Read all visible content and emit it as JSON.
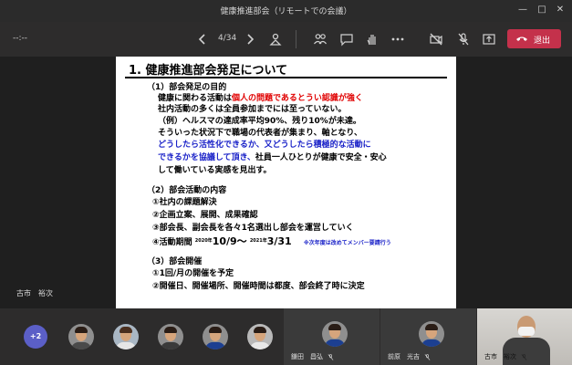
{
  "window": {
    "title": "健康推進部会（リモートでの会議）",
    "minimize": "—",
    "maximize": "□",
    "close": "✕"
  },
  "toolbar": {
    "timer": "--:--",
    "page_counter": "4/34",
    "leave_label": "退出",
    "accent": "#c4314b"
  },
  "slide": {
    "title": "1. 健康推進部会発足について",
    "section1": {
      "heading": "（1）部会発足の目的",
      "l1a": "健康に関わる活動は",
      "l1b": "個人の問題であるとうい認識が強く",
      "l2": "社内活動の多くは全員参加までには至っていない。",
      "l3": "（例）ヘルスマの達成率平均90%、残り10%が未達。",
      "l4": "そういった状況下で職場の代表者が集まり、軸となり、",
      "l5": "どうしたら活性化できるか、又どうしたら積極的な活動に",
      "l6a": "できるかを協議して頂き、",
      "l6b": "社員一人ひとりが健康で安全・安心",
      "l7": "して働いている実感を見出す。"
    },
    "section2": {
      "heading": "（2）部会活動の内容",
      "i1": "①社内の課題解決",
      "i2": "②企画立案、展開、成果確認",
      "i3": "③部会長、副会長を各々1名選出し部会を運営していく",
      "i4_label": "④活動期間",
      "i4_sup1": "2020年",
      "i4_start": "10/9〜",
      "i4_sup2": "2021年",
      "i4_end": "3/31",
      "i4_note": "※次年度は改めてメンバー要請行う"
    },
    "section3": {
      "heading": "（3）部会開催",
      "i1": "①1回/月の開催を予定",
      "i2": "②開催日、開催場所、開催時間は都度、部会終了時に決定"
    }
  },
  "presenter": {
    "name": "古市　裕次"
  },
  "gallery": {
    "overflow_count": "+2",
    "tile1_name": "鎌田　昌弘",
    "tile2_name": "前原　光吉",
    "self_name": "古市　裕次"
  },
  "colors": {
    "red_text": "#e00000",
    "blue_text": "#1a22c8",
    "more_badge": "#5b5fc7"
  }
}
